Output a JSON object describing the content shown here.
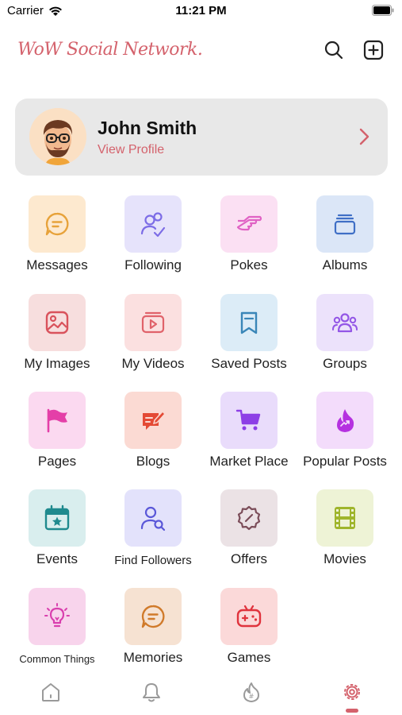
{
  "status": {
    "carrier": "Carrier",
    "time": "11:21 PM"
  },
  "header": {
    "logo": "WoW Social Network.",
    "icons": [
      "search-icon",
      "add-square-icon"
    ]
  },
  "profile": {
    "name": "John Smith",
    "link": "View Profile"
  },
  "menu": {
    "items": [
      {
        "label": "Messages",
        "icon": "message-icon",
        "tile": "#fde9cf",
        "color": "#e7a23a"
      },
      {
        "label": "Following",
        "icon": "following-icon",
        "tile": "#e6e3fb",
        "color": "#7c6ce6"
      },
      {
        "label": "Pokes",
        "icon": "poke-icon",
        "tile": "#fbe0f3",
        "color": "#e062c4"
      },
      {
        "label": "Albums",
        "icon": "album-icon",
        "tile": "#dbe6f7",
        "color": "#3f6fc6"
      },
      {
        "label": "My Images",
        "icon": "image-icon",
        "tile": "#f7dede",
        "color": "#d9525c"
      },
      {
        "label": "My Videos",
        "icon": "video-icon",
        "tile": "#fbe0e0",
        "color": "#e0626a"
      },
      {
        "label": "Saved Posts",
        "icon": "bookmark-icon",
        "tile": "#dcecf7",
        "color": "#3a86b8"
      },
      {
        "label": "Groups",
        "icon": "groups-icon",
        "tile": "#ece2fb",
        "color": "#9356e6"
      },
      {
        "label": "Pages",
        "icon": "flag-icon",
        "tile": "#fbd9f0",
        "color": "#e43fa8"
      },
      {
        "label": "Blogs",
        "icon": "blog-icon",
        "tile": "#fbdad3",
        "color": "#e44a35"
      },
      {
        "label": "Market Place",
        "icon": "cart-icon",
        "tile": "#e9dcfb",
        "color": "#8d3fe6"
      },
      {
        "label": "Popular Posts",
        "icon": "fire-icon",
        "tile": "#f3dcfb",
        "color": "#b531e0"
      },
      {
        "label": "Events",
        "icon": "calendar-icon",
        "tile": "#d9eeee",
        "color": "#1f8a8e"
      },
      {
        "label": "Find Followers",
        "icon": "find-user-icon",
        "tile": "#e3e2fb",
        "color": "#5a57d8"
      },
      {
        "label": "Offers",
        "icon": "offer-icon",
        "tile": "#ebe2e5",
        "color": "#7b4d59"
      },
      {
        "label": "Movies",
        "icon": "film-icon",
        "tile": "#eef3d6",
        "color": "#9fb52c"
      },
      {
        "label": "Common Things",
        "icon": "bulb-icon",
        "tile": "#f8d4ec",
        "color": "#d93fae"
      },
      {
        "label": "Memories",
        "icon": "memory-icon",
        "tile": "#f6e2d2",
        "color": "#d07a2a"
      },
      {
        "label": "Games",
        "icon": "gamepad-icon",
        "tile": "#fbd9d9",
        "color": "#e0333d"
      }
    ]
  },
  "tabs": {
    "icons": [
      "home-icon",
      "bell-icon",
      "trending-icon",
      "settings-icon"
    ],
    "active": "settings-icon"
  },
  "colors": {
    "accent": "#d4626c",
    "card": "#e8e8e8"
  }
}
